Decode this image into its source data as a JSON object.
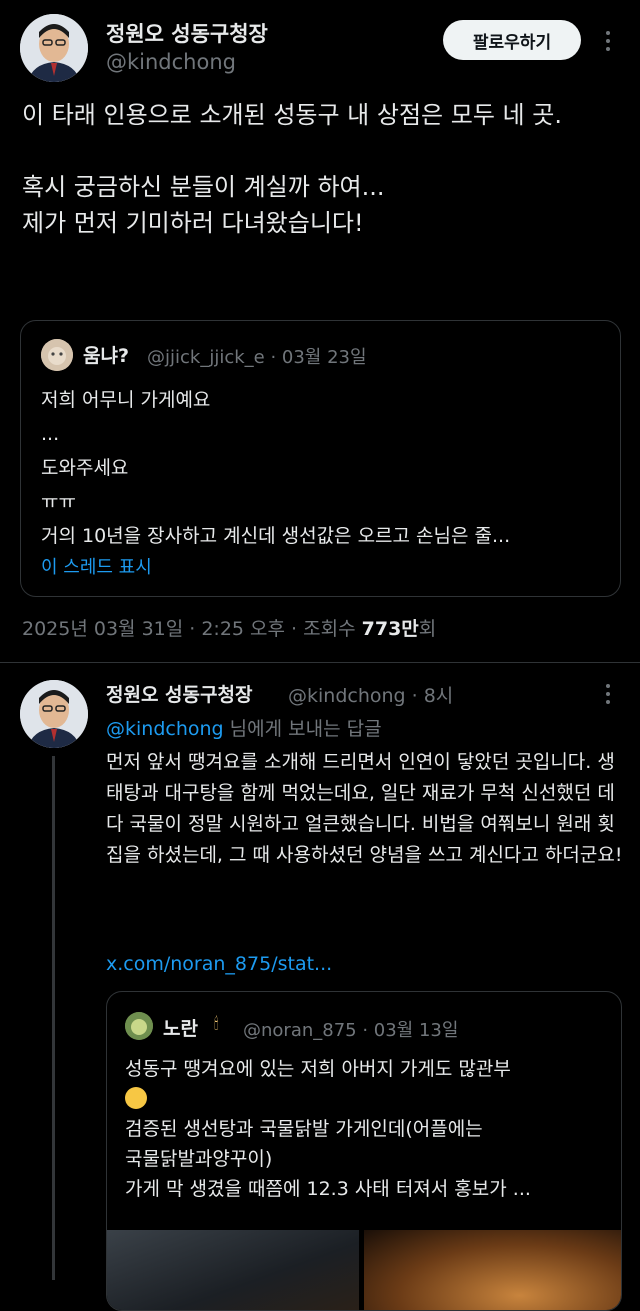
{
  "main_tweet": {
    "author_name": "정원오 성동구청장",
    "handle": "@kindchong",
    "follow_label": "팔로우하기",
    "text": "이 타래 인용으로 소개된 성동구 내 상점은 모두 네 곳.\n\n혹시 궁금하신 분들이 계실까 하여...\n제가 먼저 기미하러 다녀왔습니다!",
    "timestamp_prefix": "2025년 03월 31일 · 2:25 오후 · 조회수 ",
    "views": "773만",
    "views_suffix": "회"
  },
  "quote1": {
    "author_name": "움냐?",
    "meta": "@jjick_jjick_e · 03월 23일",
    "text": "저희 어무니 가게예요\n...\n도와주세요\nㅠㅠ\n거의 10년을 장사하고 계신데 생선값은 오르고 손님은 줄...",
    "show_thread": "이 스레드 표시"
  },
  "reply": {
    "author_name": "정원오 성동구청장",
    "meta": "@kindchong · 8시",
    "reply_to_handle": "@kindchong",
    "reply_to_suffix": " 님에게 보내는 답글",
    "text": "먼저 앞서 땡겨요를 소개해 드리면서 인연이 닿았던 곳입니다. 생태탕과 대구탕을 함께 먹었는데요, 일단 재료가 무척 신선했던 데다 국물이 정말 시원하고 얼큰했습니다. 비법을 여쭤보니 원래 횟집을 하셨는데, 그 때 사용하셨던 양념을 쓰고 계신다고 하더군요!",
    "link": "x.com/noran_875/stat..."
  },
  "quote2": {
    "author_name": "노란",
    "meta": "@noran_875 · 03월 13일",
    "text_line1": "성동구 땡겨요에 있는 저희 아버지 가게도 많관부",
    "text_rest": "검증된 생선탕과 국물닭발 가게인데(어플에는\n국물닭발과양꾸이)\n가게 막 생겼을 때쯤에 12.3 사태 터져서 홍보가 ..."
  },
  "colors": {
    "background": "#000000",
    "text": "#e7e9ea",
    "muted": "#71767b",
    "link": "#1d9bf0",
    "border": "#2f3336"
  },
  "icons": [
    "more-options-icon",
    "candle-icon",
    "crying-face-emoji"
  ]
}
